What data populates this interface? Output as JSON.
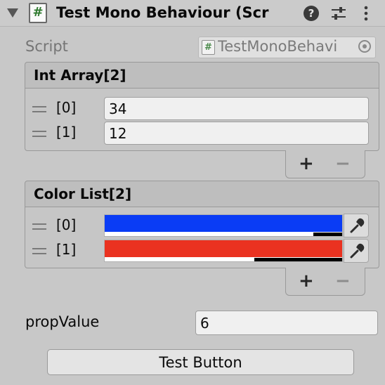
{
  "header": {
    "title": "Test Mono Behaviour (Scr",
    "script_icon_glyph": "#",
    "help_glyph": "?",
    "icons": [
      "foldout-arrow",
      "script-icon",
      "help-icon",
      "settings-sliders-icon",
      "more-vertical-icon"
    ]
  },
  "script_row": {
    "label": "Script",
    "value": "TestMonoBehavi",
    "icon_glyph": "#"
  },
  "int_array": {
    "title": "Int Array[2]",
    "items": [
      {
        "label": "[0]",
        "value": "34"
      },
      {
        "label": "[1]",
        "value": "12"
      }
    ],
    "add_label": "+",
    "remove_label": "−"
  },
  "color_list": {
    "title": "Color List[2]",
    "items": [
      {
        "label": "[0]",
        "color": "#0a3cf5",
        "alpha": 0.88
      },
      {
        "label": "[1]",
        "color": "#ea3220",
        "alpha": 0.63
      }
    ],
    "add_label": "+",
    "remove_label": "−"
  },
  "prop": {
    "label": "propValue",
    "value": "6"
  },
  "test_button": {
    "label": "Test Button"
  }
}
